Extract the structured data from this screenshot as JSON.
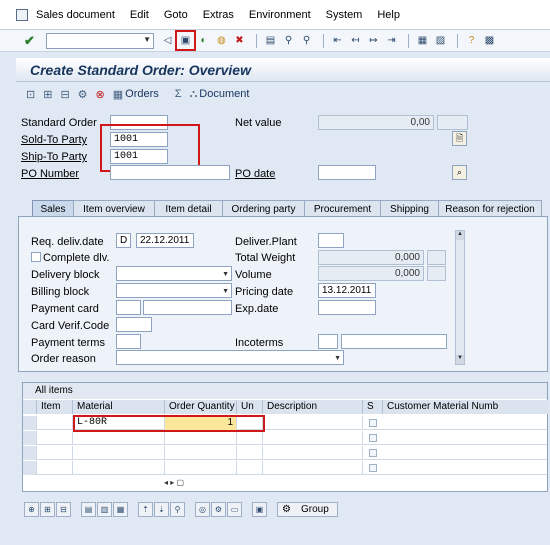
{
  "menu": [
    "Sales document",
    "Edit",
    "Goto",
    "Extras",
    "Environment",
    "System",
    "Help"
  ],
  "title": "Create Standard Order: Overview",
  "app_toolbar": {
    "orders_label": "Orders",
    "document_label": "Document"
  },
  "header": {
    "standard_order_label": "Standard Order",
    "standard_order_value": "",
    "net_value_label": "Net value",
    "net_value_value": "0,00",
    "sold_to_label": "Sold-To Party",
    "sold_to_value": "1001",
    "ship_to_label": "Ship-To Party",
    "ship_to_value": "1001",
    "po_number_label": "PO Number",
    "po_date_label": "PO date"
  },
  "tabs": [
    "Sales",
    "Item overview",
    "Item detail",
    "Ordering party",
    "Procurement",
    "Shipping",
    "Reason for rejection"
  ],
  "sales_tab": {
    "req_deliv_date_label": "Req. deliv.date",
    "req_deliv_date_type": "D",
    "req_deliv_date_value": "22.12.2011",
    "deliver_plant_label": "Deliver.Plant",
    "complete_dlv_label": "Complete dlv.",
    "total_weight_label": "Total Weight",
    "total_weight_value": "0,000",
    "delivery_block_label": "Delivery block",
    "volume_label": "Volume",
    "volume_value": "0,000",
    "billing_block_label": "Billing block",
    "pricing_date_label": "Pricing date",
    "pricing_date_value": "13.12.2011",
    "payment_card_label": "Payment card",
    "exp_date_label": "Exp.date",
    "card_verif_label": "Card Verif.Code",
    "payment_terms_label": "Payment terms",
    "incoterms_label": "Incoterms",
    "order_reason_label": "Order reason"
  },
  "items_table": {
    "caption": "All items",
    "columns": [
      "Item",
      "Material",
      "Order Quantity",
      "Un",
      "Description",
      "S",
      "Customer Material Numb"
    ],
    "rows": [
      {
        "item": "",
        "material": "L-80R",
        "quantity": "1",
        "unit": "",
        "description": ""
      }
    ]
  },
  "bottom_toolbar": {
    "group_label": "Group"
  }
}
